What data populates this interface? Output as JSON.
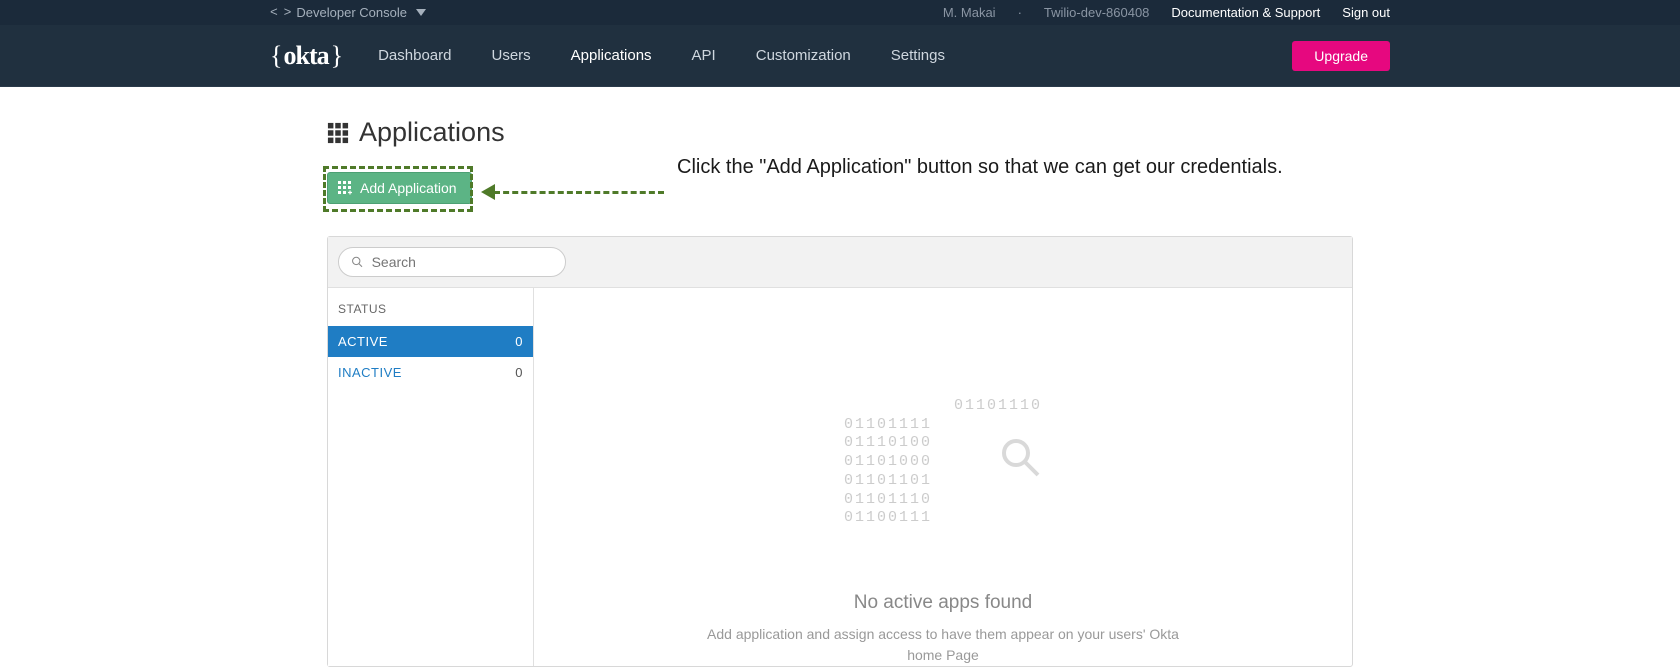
{
  "topbar": {
    "console_label": "Developer Console",
    "user_name": "M. Makai",
    "org_name": "Twilio-dev-860408",
    "doc_support": "Documentation & Support",
    "sign_out": "Sign out"
  },
  "nav": {
    "brand": "okta",
    "items": [
      {
        "label": "Dashboard",
        "active": false
      },
      {
        "label": "Users",
        "active": false
      },
      {
        "label": "Applications",
        "active": true
      },
      {
        "label": "API",
        "active": false
      },
      {
        "label": "Customization",
        "active": false
      },
      {
        "label": "Settings",
        "active": false
      }
    ],
    "upgrade": "Upgrade"
  },
  "page": {
    "title": "Applications",
    "add_button": "Add Application",
    "annotation": "Click the \"Add Application\" button so that we can get our credentials."
  },
  "search": {
    "placeholder": "Search"
  },
  "sidebar": {
    "status_header": "STATUS",
    "items": [
      {
        "label": "ACTIVE",
        "count": "0",
        "state": "active"
      },
      {
        "label": "INACTIVE",
        "count": "0",
        "state": "inactive"
      }
    ]
  },
  "empty": {
    "binary": "01101110\n01101111\n01110100\n01101000\n01101101\n01101110\n01100111",
    "title": "No active apps found",
    "subtitle": "Add application and assign access to have them appear on your users' Okta home Page"
  }
}
